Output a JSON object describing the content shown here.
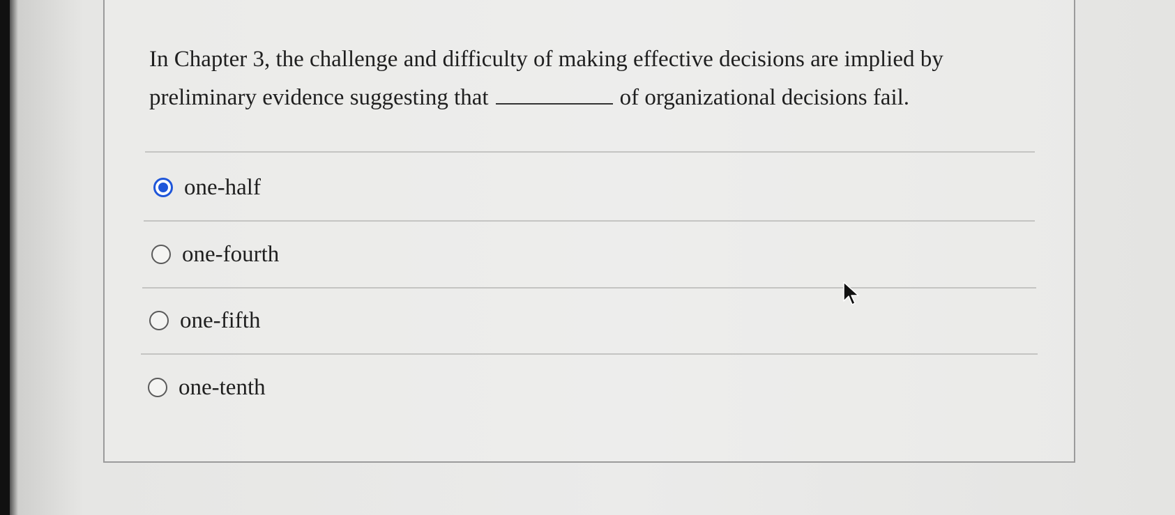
{
  "question": {
    "text_before_blank": "In Chapter 3, the challenge and difficulty of making effective decisions are implied by preliminary evidence suggesting that",
    "text_after_blank": "of organizational decisions fail."
  },
  "options": [
    {
      "label": "one-half",
      "selected": true
    },
    {
      "label": "one-fourth",
      "selected": false
    },
    {
      "label": "one-fifth",
      "selected": false
    },
    {
      "label": "one-tenth",
      "selected": false
    }
  ],
  "colors": {
    "selected_radio": "#1f56d9",
    "text": "#1f1f1f"
  },
  "icons": {
    "pointer": "mouse-pointer-icon"
  }
}
